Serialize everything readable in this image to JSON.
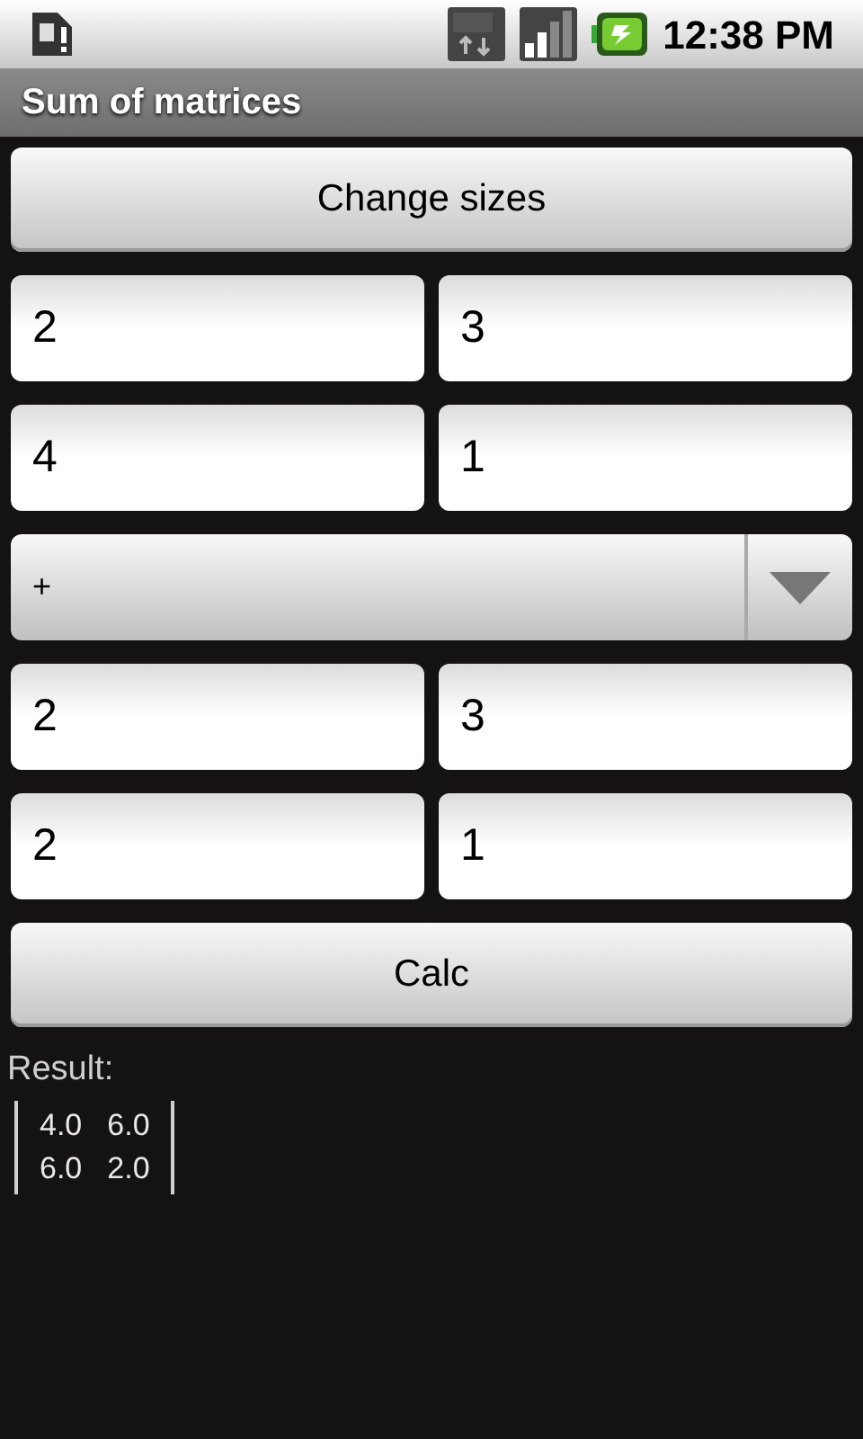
{
  "status_bar": {
    "time": "12:38 PM"
  },
  "title": "Sum of matrices",
  "change_sizes_button": "Change sizes",
  "matrix_a": [
    [
      "2",
      "3"
    ],
    [
      "4",
      "1"
    ]
  ],
  "operator": "+",
  "matrix_b": [
    [
      "2",
      "3"
    ],
    [
      "2",
      "1"
    ]
  ],
  "calc_button": "Calc",
  "result_label": "Result:",
  "result": [
    [
      "4.0",
      "6.0"
    ],
    [
      "6.0",
      "2.0"
    ]
  ]
}
